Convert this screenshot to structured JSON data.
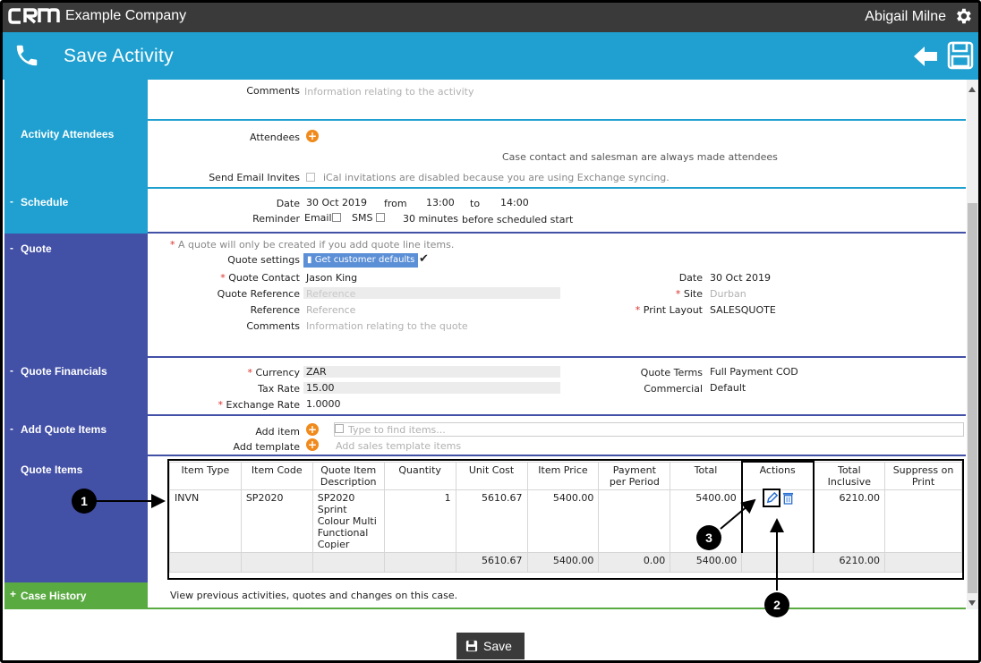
{
  "header": {
    "company": "Example Company",
    "user": "Abigail Milne"
  },
  "title": {
    "text": "Save Activity"
  },
  "activity": {
    "comments_label": "Comments",
    "comments_placeholder": "Information relating to the activity"
  },
  "attendees": {
    "section": "Activity Attendees",
    "attendees_label": "Attendees",
    "note": "Case contact and salesman are always made attendees",
    "send_email_label": "Send Email Invites",
    "send_email_note": "iCal invitations are disabled because you are using Exchange syncing."
  },
  "schedule": {
    "section": "Schedule",
    "toggle": "-",
    "date_label": "Date",
    "date": "30 Oct 2019",
    "from_label": "from",
    "from": "13:00",
    "to_label": "to",
    "to": "14:00",
    "reminder_label": "Reminder",
    "email_label": "Email",
    "sms_label": "SMS",
    "minutes": "30 minutes",
    "before": "before scheduled start"
  },
  "quote": {
    "section": "Quote",
    "toggle": "-",
    "note": "A quote will only be created if you add quote line items.",
    "settings_label": "Quote settings",
    "defaults_button": "Get customer defaults",
    "contact_label": "Quote Contact",
    "contact": "Jason King",
    "quote_ref_label": "Quote Reference",
    "quote_ref_placeholder": "Reference",
    "ref_label": "Reference",
    "ref_placeholder": "Reference",
    "comments_label": "Comments",
    "comments_placeholder": "Information relating to the quote",
    "date_label": "Date",
    "date": "30 Oct 2019",
    "site_label": "Site",
    "site_placeholder": "Durban",
    "print_label": "Print Layout",
    "print": "SALESQUOTE",
    "required_mark": "*"
  },
  "financials": {
    "section": "Quote Financials",
    "toggle": "-",
    "currency_label": "Currency",
    "currency": "ZAR",
    "tax_label": "Tax Rate",
    "tax": "15.00",
    "exchange_label": "Exchange Rate",
    "exchange": "1.0000",
    "terms_label": "Quote Terms",
    "terms": "Full Payment COD",
    "commercial_label": "Commercial",
    "commercial": "Default"
  },
  "add_items": {
    "section": "Add Quote Items",
    "toggle": "-",
    "add_item_label": "Add item",
    "item_placeholder": "Type to find items...",
    "add_template_label": "Add template",
    "template_placeholder": "Add sales template items"
  },
  "items": {
    "section": "Quote Items",
    "headers": [
      "Item Type",
      "Item Code",
      "Quote Item Description",
      "Quantity",
      "Unit Cost",
      "Item Price",
      "Payment per Period",
      "Total",
      "Actions",
      "Total Inclusive",
      "Suppress on Print"
    ],
    "row": {
      "type": "INVN",
      "code": "SP2020",
      "description": "SP2020 Sprint Colour Multi Functional Copier",
      "quantity": "1",
      "unit_cost": "5610.67",
      "price": "5400.00",
      "payment": "",
      "total": "5400.00",
      "total_inclusive": "6210.00"
    },
    "totals": {
      "unit_cost": "5610.67",
      "price": "5400.00",
      "payment": "0.00",
      "total": "5400.00",
      "total_inclusive": "6210.00"
    }
  },
  "case_history": {
    "section": "Case History",
    "toggle": "+",
    "note": "View previous activities, quotes and changes on this case."
  },
  "callouts": [
    "1",
    "2",
    "3"
  ],
  "footer": {
    "save": "Save"
  },
  "colors": {
    "header": "#3a3a3a",
    "titlebar": "#1fa0d0",
    "navy": "#4250a6",
    "green": "#5aaa42",
    "accent": "#f08a1c"
  },
  "icons": [
    "crm-logo",
    "gear-icon",
    "phone-icon",
    "back-arrow-icon",
    "save-icon",
    "plus-icon",
    "edit-icon",
    "delete-icon",
    "bookmark-icon",
    "checkmark-icon"
  ]
}
